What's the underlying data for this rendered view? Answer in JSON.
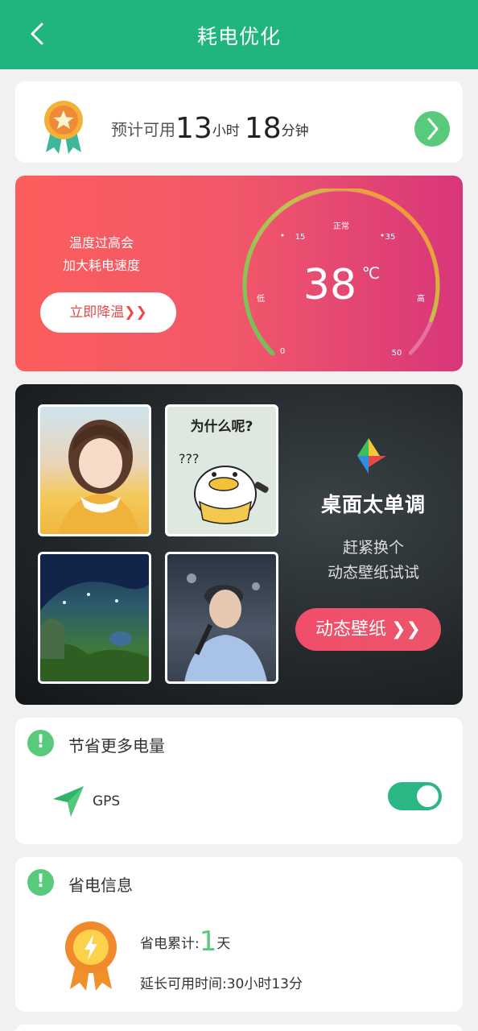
{
  "header": {
    "title": "耗电优化"
  },
  "battery_time": {
    "prefix": "预计可用",
    "hours": "13",
    "hours_unit": "小时",
    "minutes": "18",
    "minutes_unit": "分钟"
  },
  "temperature": {
    "message_line1": "温度过高会",
    "message_line2": "加大耗电速度",
    "cool_button": "立即降温",
    "value": "38",
    "unit": "℃",
    "label_normal": "正常",
    "label_low": "低",
    "label_high": "高",
    "tick_15": "15",
    "tick_35": "35",
    "tick_0": "0",
    "tick_50": "50",
    "gauge_level": 38
  },
  "wallpaper": {
    "thumb2_caption": "为什么呢?",
    "title": "桌面太单调",
    "subtitle_line1": "赶紧换个",
    "subtitle_line2": "动态壁纸试试",
    "button": "动态壁纸"
  },
  "save_more": {
    "title": "节省更多电量",
    "gps_label": "GPS",
    "gps_enabled": true
  },
  "save_info": {
    "title": "省电信息",
    "accumulated_label": "省电累计:",
    "accumulated_value": "1",
    "accumulated_unit": "天",
    "extended_label": "延长可用时间:",
    "extended_value": "30小时13分"
  },
  "colors": {
    "primary_green": "#20b57f",
    "accent_green": "#59c97b",
    "temp_gradient_start": "#fb5e5c",
    "temp_gradient_end": "#d8367a"
  }
}
